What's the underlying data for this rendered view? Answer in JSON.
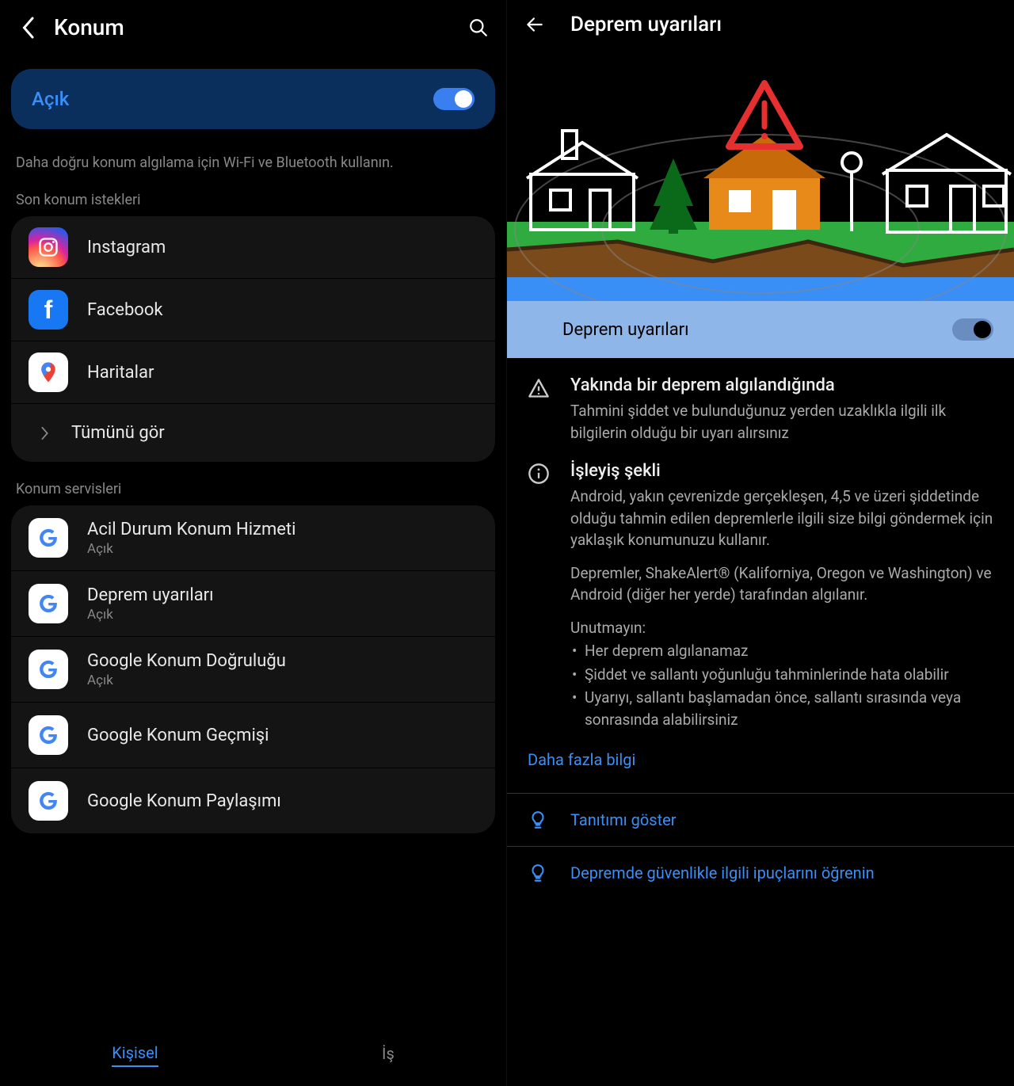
{
  "left": {
    "title": "Konum",
    "toggle_label": "Açık",
    "hint": "Daha doğru konum algılama için Wi-Fi ve Bluetooth kullanın.",
    "recent_section": "Son konum istekleri",
    "apps": [
      {
        "name": "Instagram",
        "icon": "instagram"
      },
      {
        "name": "Facebook",
        "icon": "facebook"
      },
      {
        "name": "Haritalar",
        "icon": "maps"
      }
    ],
    "view_all": "Tümünü gör",
    "services_section": "Konum servisleri",
    "services": [
      {
        "title": "Acil Durum Konum Hizmeti",
        "sub": "Açık"
      },
      {
        "title": "Deprem uyarıları",
        "sub": "Açık"
      },
      {
        "title": "Google Konum Doğruluğu",
        "sub": "Açık"
      },
      {
        "title": "Google Konum Geçmişi",
        "sub": ""
      },
      {
        "title": "Google Konum Paylaşımı",
        "sub": ""
      }
    ],
    "tabs": {
      "personal": "Kişisel",
      "work": "İş"
    }
  },
  "right": {
    "title": "Deprem uyarıları",
    "toggle_label": "Deprem uyarıları",
    "section1": {
      "title": "Yakında bir deprem algılandığında",
      "body": "Tahmini şiddet ve bulunduğunuz yerden uzaklıkla ilgili ilk bilgilerin olduğu bir uyarı alırsınız"
    },
    "section2": {
      "title": "İşleyiş şekli",
      "p1": "Android, yakın çevrenizde gerçekleşen, 4,5 ve üzeri şiddetinde olduğu tahmin edilen depremlerle ilgili size bilgi göndermek için yaklaşık konumunuzu kullanır.",
      "p2": "Depremler, ShakeAlert® (Kaliforniya, Oregon ve Washington) ve Android (diğer her yerde) tarafından algılanır.",
      "remember_label": "Unutmayın:",
      "bullets": [
        "Her deprem algılanamaz",
        "Şiddet ve sallantı yoğunluğu tahminlerinde hata olabilir",
        "Uyarıyı, sallantı başlamadan önce, sallantı sırasında veya sonrasında alabilirsiniz"
      ]
    },
    "more_link": "Daha fazla bilgi",
    "tips": [
      "Tanıtımı göster",
      "Depremde güvenlikle ilgili ipuçlarını öğrenin"
    ]
  }
}
